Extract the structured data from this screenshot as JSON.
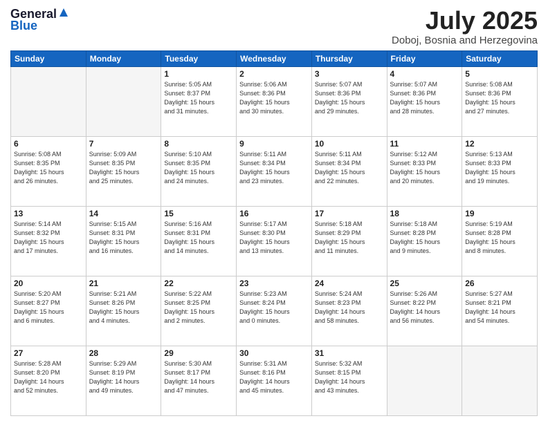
{
  "header": {
    "logo_line1": "General",
    "logo_line2": "Blue",
    "month": "July 2025",
    "location": "Doboj, Bosnia and Herzegovina"
  },
  "weekdays": [
    "Sunday",
    "Monday",
    "Tuesday",
    "Wednesday",
    "Thursday",
    "Friday",
    "Saturday"
  ],
  "weeks": [
    [
      {
        "day": "",
        "detail": ""
      },
      {
        "day": "",
        "detail": ""
      },
      {
        "day": "1",
        "detail": "Sunrise: 5:05 AM\nSunset: 8:37 PM\nDaylight: 15 hours\nand 31 minutes."
      },
      {
        "day": "2",
        "detail": "Sunrise: 5:06 AM\nSunset: 8:36 PM\nDaylight: 15 hours\nand 30 minutes."
      },
      {
        "day": "3",
        "detail": "Sunrise: 5:07 AM\nSunset: 8:36 PM\nDaylight: 15 hours\nand 29 minutes."
      },
      {
        "day": "4",
        "detail": "Sunrise: 5:07 AM\nSunset: 8:36 PM\nDaylight: 15 hours\nand 28 minutes."
      },
      {
        "day": "5",
        "detail": "Sunrise: 5:08 AM\nSunset: 8:36 PM\nDaylight: 15 hours\nand 27 minutes."
      }
    ],
    [
      {
        "day": "6",
        "detail": "Sunrise: 5:08 AM\nSunset: 8:35 PM\nDaylight: 15 hours\nand 26 minutes."
      },
      {
        "day": "7",
        "detail": "Sunrise: 5:09 AM\nSunset: 8:35 PM\nDaylight: 15 hours\nand 25 minutes."
      },
      {
        "day": "8",
        "detail": "Sunrise: 5:10 AM\nSunset: 8:35 PM\nDaylight: 15 hours\nand 24 minutes."
      },
      {
        "day": "9",
        "detail": "Sunrise: 5:11 AM\nSunset: 8:34 PM\nDaylight: 15 hours\nand 23 minutes."
      },
      {
        "day": "10",
        "detail": "Sunrise: 5:11 AM\nSunset: 8:34 PM\nDaylight: 15 hours\nand 22 minutes."
      },
      {
        "day": "11",
        "detail": "Sunrise: 5:12 AM\nSunset: 8:33 PM\nDaylight: 15 hours\nand 20 minutes."
      },
      {
        "day": "12",
        "detail": "Sunrise: 5:13 AM\nSunset: 8:33 PM\nDaylight: 15 hours\nand 19 minutes."
      }
    ],
    [
      {
        "day": "13",
        "detail": "Sunrise: 5:14 AM\nSunset: 8:32 PM\nDaylight: 15 hours\nand 17 minutes."
      },
      {
        "day": "14",
        "detail": "Sunrise: 5:15 AM\nSunset: 8:31 PM\nDaylight: 15 hours\nand 16 minutes."
      },
      {
        "day": "15",
        "detail": "Sunrise: 5:16 AM\nSunset: 8:31 PM\nDaylight: 15 hours\nand 14 minutes."
      },
      {
        "day": "16",
        "detail": "Sunrise: 5:17 AM\nSunset: 8:30 PM\nDaylight: 15 hours\nand 13 minutes."
      },
      {
        "day": "17",
        "detail": "Sunrise: 5:18 AM\nSunset: 8:29 PM\nDaylight: 15 hours\nand 11 minutes."
      },
      {
        "day": "18",
        "detail": "Sunrise: 5:18 AM\nSunset: 8:28 PM\nDaylight: 15 hours\nand 9 minutes."
      },
      {
        "day": "19",
        "detail": "Sunrise: 5:19 AM\nSunset: 8:28 PM\nDaylight: 15 hours\nand 8 minutes."
      }
    ],
    [
      {
        "day": "20",
        "detail": "Sunrise: 5:20 AM\nSunset: 8:27 PM\nDaylight: 15 hours\nand 6 minutes."
      },
      {
        "day": "21",
        "detail": "Sunrise: 5:21 AM\nSunset: 8:26 PM\nDaylight: 15 hours\nand 4 minutes."
      },
      {
        "day": "22",
        "detail": "Sunrise: 5:22 AM\nSunset: 8:25 PM\nDaylight: 15 hours\nand 2 minutes."
      },
      {
        "day": "23",
        "detail": "Sunrise: 5:23 AM\nSunset: 8:24 PM\nDaylight: 15 hours\nand 0 minutes."
      },
      {
        "day": "24",
        "detail": "Sunrise: 5:24 AM\nSunset: 8:23 PM\nDaylight: 14 hours\nand 58 minutes."
      },
      {
        "day": "25",
        "detail": "Sunrise: 5:26 AM\nSunset: 8:22 PM\nDaylight: 14 hours\nand 56 minutes."
      },
      {
        "day": "26",
        "detail": "Sunrise: 5:27 AM\nSunset: 8:21 PM\nDaylight: 14 hours\nand 54 minutes."
      }
    ],
    [
      {
        "day": "27",
        "detail": "Sunrise: 5:28 AM\nSunset: 8:20 PM\nDaylight: 14 hours\nand 52 minutes."
      },
      {
        "day": "28",
        "detail": "Sunrise: 5:29 AM\nSunset: 8:19 PM\nDaylight: 14 hours\nand 49 minutes."
      },
      {
        "day": "29",
        "detail": "Sunrise: 5:30 AM\nSunset: 8:17 PM\nDaylight: 14 hours\nand 47 minutes."
      },
      {
        "day": "30",
        "detail": "Sunrise: 5:31 AM\nSunset: 8:16 PM\nDaylight: 14 hours\nand 45 minutes."
      },
      {
        "day": "31",
        "detail": "Sunrise: 5:32 AM\nSunset: 8:15 PM\nDaylight: 14 hours\nand 43 minutes."
      },
      {
        "day": "",
        "detail": ""
      },
      {
        "day": "",
        "detail": ""
      }
    ]
  ]
}
